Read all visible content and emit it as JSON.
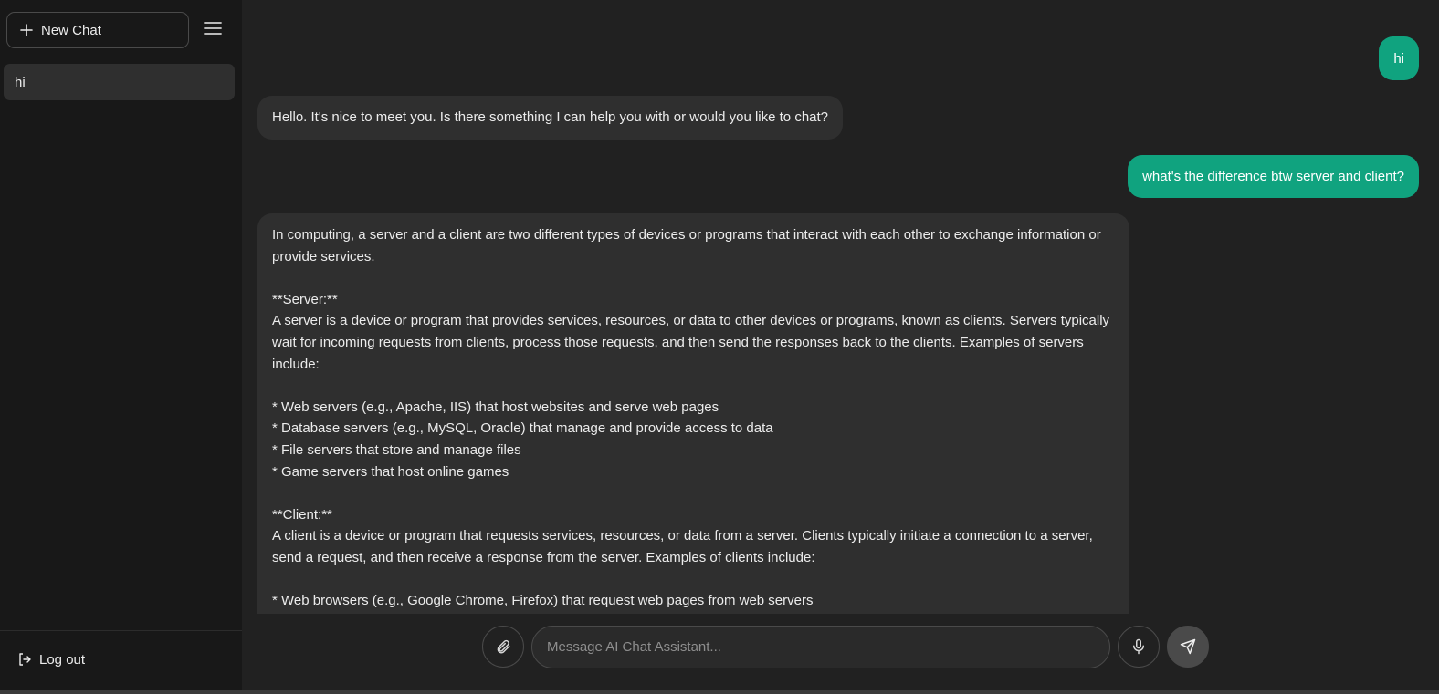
{
  "sidebar": {
    "new_chat_label": "New Chat",
    "history": [
      {
        "label": "hi"
      }
    ],
    "logout_label": "Log out"
  },
  "conversation": {
    "messages": [
      {
        "role": "user",
        "text": "hi"
      },
      {
        "role": "assistant",
        "text": "Hello. It's nice to meet you. Is there something I can help you with or would you like to chat?"
      },
      {
        "role": "user",
        "text": "what's the difference btw server and client?"
      },
      {
        "role": "assistant",
        "lines": [
          "In computing, a server and a client are two different types of devices or programs that interact with each other to exchange information or provide services.",
          "",
          "**Server:**",
          "A server is a device or program that provides services, resources, or data to other devices or programs, known as clients. Servers typically wait for incoming requests from clients, process those requests, and then send the responses back to the clients. Examples of servers include:",
          "",
          "* Web servers (e.g., Apache, IIS) that host websites and serve web pages",
          "* Database servers (e.g., MySQL, Oracle) that manage and provide access to data",
          "* File servers that store and manage files",
          "* Game servers that host online games",
          "",
          "**Client:**",
          "A client is a device or program that requests services, resources, or data from a server. Clients typically initiate a connection to a server, send a request, and then receive a response from the server. Examples of clients include:",
          "",
          "* Web browsers (e.g., Google Chrome, Firefox) that request web pages from web servers"
        ]
      }
    ]
  },
  "composer": {
    "placeholder": "Message AI Chat Assistant...",
    "value": ""
  },
  "icons": {
    "new_chat": "plus-icon",
    "menu": "hamburger-icon",
    "logout": "logout-icon",
    "attach": "paperclip-icon",
    "mic": "microphone-icon",
    "send": "send-icon"
  },
  "colors": {
    "user_bubble": "#10a37f",
    "assistant_bubble": "#2f2f2f",
    "sidebar_bg": "#181818",
    "main_bg": "#212121"
  }
}
